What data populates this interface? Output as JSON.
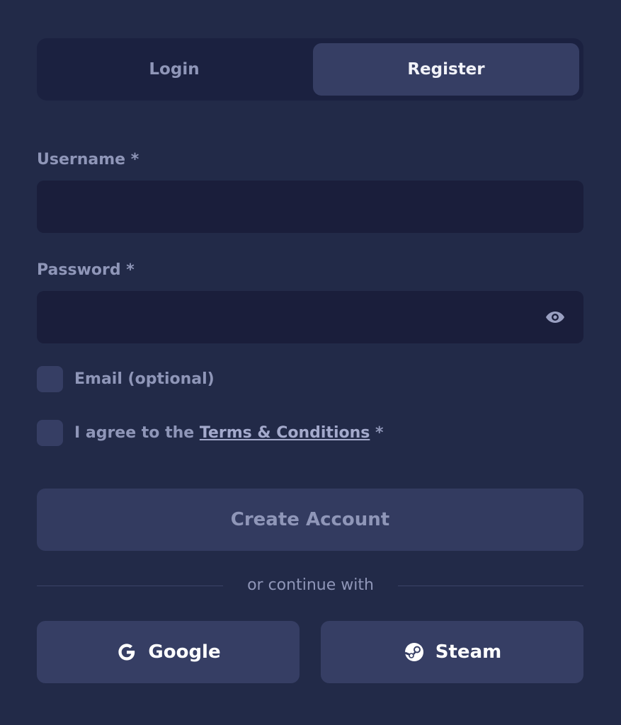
{
  "tabs": {
    "login_label": "Login",
    "register_label": "Register",
    "active": "Register"
  },
  "form": {
    "username_label": "Username *",
    "username_value": "",
    "password_label": "Password *",
    "password_value": "",
    "email_checkbox_label": "Email (optional)",
    "terms_prefix": "I agree to the ",
    "terms_link": "Terms & Conditions",
    "terms_suffix": " *",
    "create_label": "Create Account"
  },
  "divider": {
    "text": "or continue with"
  },
  "social": {
    "google_label": "Google",
    "steam_label": "Steam"
  },
  "icons": {
    "password_toggle": "eye-icon",
    "google": "google-icon",
    "steam": "steam-icon"
  },
  "colors": {
    "background": "#222a48",
    "input_bg": "#1a1e3b",
    "button_bg": "#363e64",
    "muted_text": "#8f96b8"
  }
}
